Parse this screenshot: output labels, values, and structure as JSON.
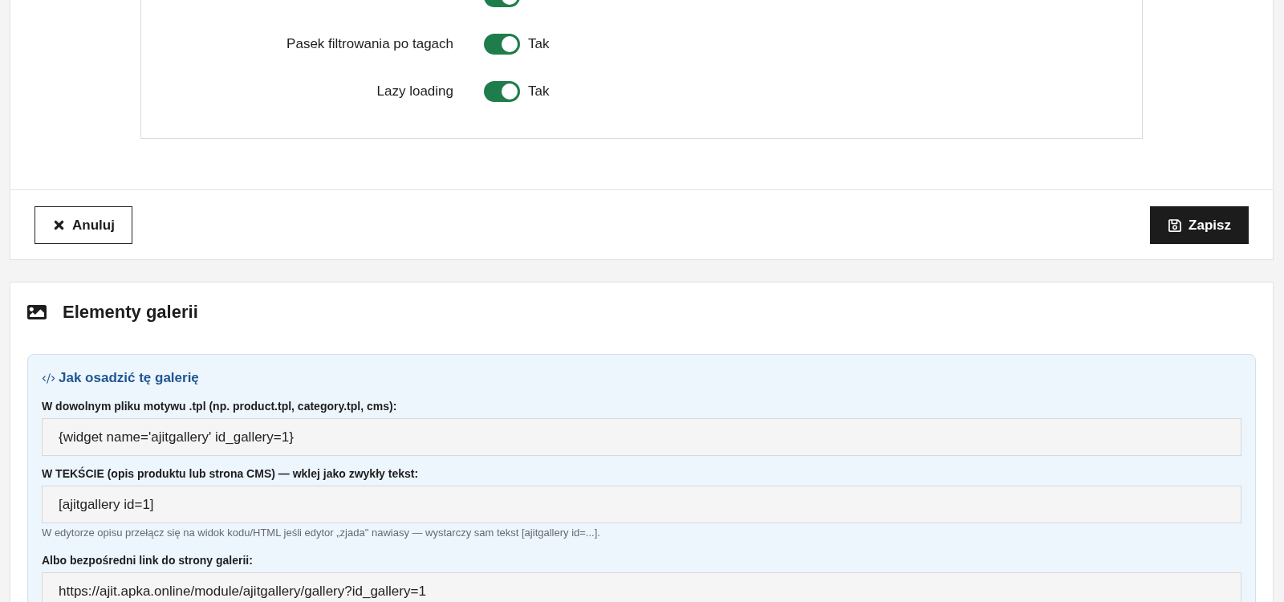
{
  "settings": {
    "rows": [
      {
        "on": true
      },
      {
        "label": "Pasek filtrowania po tagach",
        "on": true,
        "status_text": "Tak"
      },
      {
        "label": "Lazy loading",
        "on": true,
        "status_text": "Tak"
      }
    ]
  },
  "form_actions": {
    "cancel": "Anuluj",
    "save": "Zapisz"
  },
  "gallery_elements": {
    "title": "Elementy galerii",
    "embed_help": {
      "title": "Jak osadzić tę galerię",
      "blocks": [
        {
          "label": "W dowolnym pliku motywu .tpl (np. product.tpl, category.tpl, cms):",
          "value": "{widget name='ajitgallery' id_gallery=1}"
        },
        {
          "label": "W TEKŚCIE (opis produktu lub strona CMS) — wklej jako zwykły tekst:",
          "value": "[ajitgallery id=1]",
          "note": "W edytorze opisu przełącz się na widok kodu/HTML jeśli edytor „zjada\" nawiasy — wystarczy sam tekst [ajitgallery id=...]."
        },
        {
          "label": "Albo bezpośredni link do strony galerii:",
          "value": "https://ajit.apka.online/module/ajitgallery/gallery?id_gallery=1"
        }
      ]
    }
  }
}
